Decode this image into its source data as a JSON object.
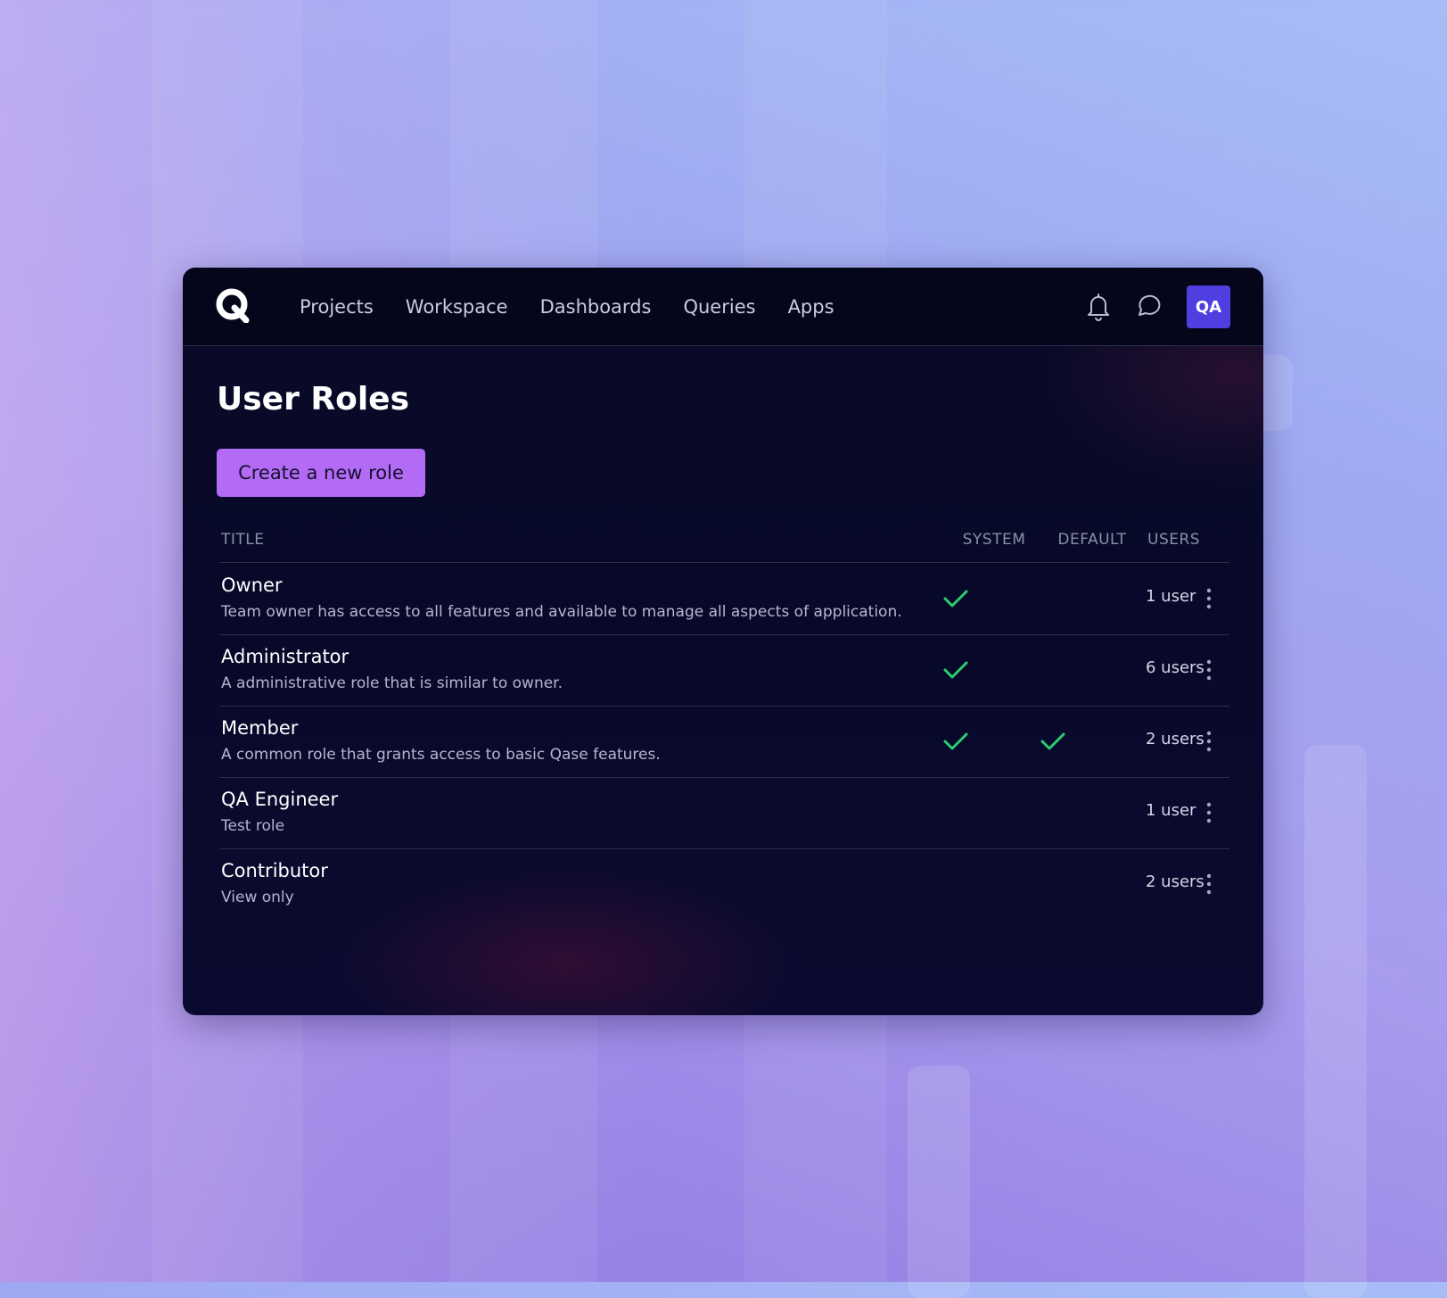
{
  "header": {
    "logo_letter": "Q",
    "nav": [
      "Projects",
      "Workspace",
      "Dashboards",
      "Queries",
      "Apps"
    ],
    "icons": [
      "bell-icon",
      "chat-icon"
    ],
    "avatar_initials": "QA"
  },
  "page": {
    "title": "User Roles",
    "create_button_label": "Create a new role"
  },
  "table": {
    "columns": {
      "title": "TITLE",
      "system": "SYSTEM",
      "default": "DEFAULT",
      "users": "USERS"
    },
    "rows": [
      {
        "name": "Owner",
        "description": "Team owner has access to all features and available to manage all aspects of application.",
        "system": true,
        "default": false,
        "users": "1 user"
      },
      {
        "name": "Administrator",
        "description": "A administrative role that is similar to owner.",
        "system": true,
        "default": false,
        "users": "6 users"
      },
      {
        "name": "Member",
        "description": "A common role that grants access to basic Qase features.",
        "system": true,
        "default": true,
        "users": "2 users"
      },
      {
        "name": "QA Engineer",
        "description": "Test role",
        "system": false,
        "default": false,
        "users": "1 user"
      },
      {
        "name": "Contributor",
        "description": "View only",
        "system": false,
        "default": false,
        "users": "2 users"
      }
    ]
  },
  "colors": {
    "accent_button": "#b36bf5",
    "check_green": "#2ecc71",
    "avatar_bg": "#4f3fe0",
    "window_bg": "#080a26"
  }
}
